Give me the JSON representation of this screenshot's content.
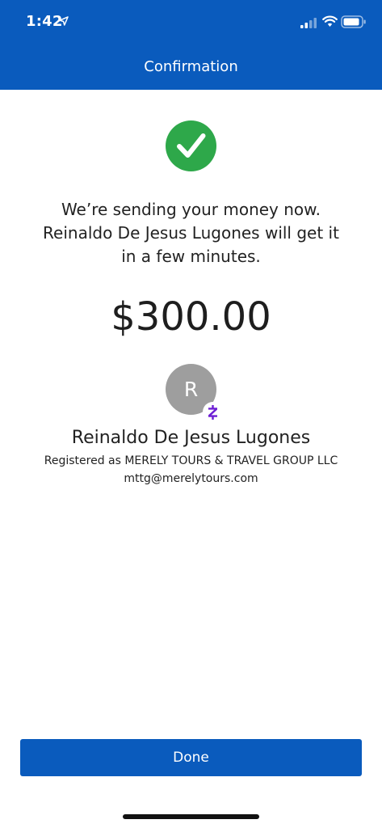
{
  "status_bar": {
    "time": "1:42",
    "icons": [
      "location-arrow-icon",
      "cellular-signal-icon",
      "wifi-icon",
      "battery-icon"
    ]
  },
  "header": {
    "title": "Confirmation",
    "background_color": "#0a5bbd"
  },
  "confirmation": {
    "icon": "checkmark-circle-icon",
    "icon_color": "#2ea84a",
    "message_line1": "We’re sending your money now.",
    "message_line2": "Reinaldo De Jesus Lugones will get it",
    "message_line3": "in a few minutes.",
    "amount": "$300.00"
  },
  "recipient": {
    "avatar_initial": "R",
    "badge_icon": "zelle-icon",
    "badge_color": "#6d1ed4",
    "name": "Reinaldo De Jesus Lugones",
    "registered_as": "Registered as MERELY TOURS & TRAVEL GROUP LLC",
    "email": "mttg@merelytours.com"
  },
  "actions": {
    "done_label": "Done",
    "button_color": "#0a5bbd"
  }
}
